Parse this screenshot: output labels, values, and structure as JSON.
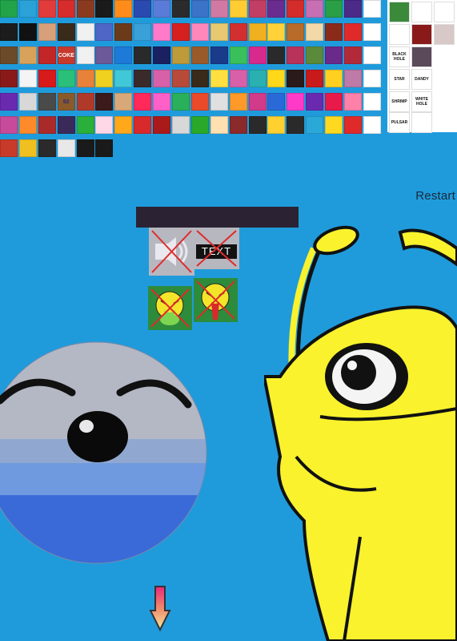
{
  "header": {
    "restart_label": "Restart"
  },
  "icon_grid": {
    "rows": [
      [
        "#22a34a",
        "#2aa2d8",
        "#e23b3b",
        "#d62c2c",
        "#8a3b1f",
        "#1a1a1a",
        "#ff8c1a",
        "#2a4ab0",
        "#5b7bd8",
        "#2b2b2b",
        "#3a73c8",
        "#d07aa3",
        "#ffcc33",
        "#c33e64",
        "#6a2c8e",
        "#d42b2b",
        "#c86fb3",
        "#2a9f45",
        "#4b2a88",
        "#ffffff"
      ],
      [
        "#1c1c1c",
        "#111111",
        "#d8a07a",
        "#3a2a1a",
        "#f0f0f0",
        "#4e67c6",
        "#6b3a1a",
        "#3aa0d8",
        "#ff7ac8",
        "#d61f1f",
        "#ff88bb",
        "#e8c870",
        "#d23030",
        "#f0b020",
        "#ffd23a",
        "#b86c2a",
        "#f3d8a8",
        "#8a2a1a",
        "#e02a2a",
        "#ffffff"
      ],
      [
        "#6b4a2a",
        "#d9a25a",
        "#c22626",
        "#c7392c",
        "#f0f0f0",
        "#6b5a9a",
        "#1d7ad8",
        "#2a2a2a",
        "#1a2060",
        "#bd9a3a",
        "#9a5a2a",
        "#1a3a8a",
        "#3ac05a",
        "#d82a8c",
        "#2a2a2a",
        "#b8325a",
        "#5a8a3a",
        "#6a2a8a",
        "#b22a3a",
        "#ffffff"
      ],
      [
        "#8a1a1a",
        "#f4f4f4",
        "#d81a1a",
        "#2ac07a",
        "#e8823a",
        "#f0d020",
        "#40c8d8",
        "#3a2a2a",
        "#d860a8",
        "#b84a3a",
        "#3a2a1a",
        "#ffe040",
        "#d860a8",
        "#2ab0b0",
        "#ffd81a",
        "#2a1a1a",
        "#c81a1a",
        "#ffd020",
        "#c07aa8",
        "#ffffff"
      ],
      [
        "#6a2ab0",
        "#d8d8d8",
        "#4a4a4a",
        "#8a5a2a",
        "#b03a2a",
        "#3a1a1a",
        "#d8a878",
        "#ff2a5a",
        "#ff60c8",
        "#2ab05a",
        "#e84a2a",
        "#e0e0e0",
        "#ff9a2a",
        "#d23a8a",
        "#2a6ad8",
        "#ff3ac8",
        "#6a2ab0",
        "#e81a4a",
        "#ff80a8",
        "#ffffff"
      ],
      [
        "#c84a9a",
        "#ff8a2a",
        "#aa2a2a",
        "#3a2a5a",
        "#2ab03a",
        "#ffd8e8",
        "#ffa81a",
        "#d82a2a",
        "#aa1a1a",
        "#d8d8d8",
        "#2aa82a",
        "#ffe0b0",
        "#8a2a2a",
        "#2a2a2a",
        "#ffd030",
        "#2a2a2a",
        "#2aa8d8",
        "#ffd820",
        "#e02a2a",
        "#ffffff"
      ],
      [
        "#c83a2a",
        "#f0c020",
        "#2a2a2a",
        "#e8e8e8",
        "#1a1a1a",
        "#1a1a1a",
        "",
        "",
        "",
        "",
        "",
        "",
        "",
        "",
        "",
        "",
        "",
        "",
        "",
        ""
      ]
    ],
    "texts": {
      "coke": "COKE",
      "ninety_two": "92"
    }
  },
  "side_panel": {
    "items": [
      "BLACK HOLE",
      "STAR",
      "DANDY",
      "SHRIMP",
      "WHITE HOLE",
      "PULSAR"
    ]
  },
  "stage": {
    "text_tile_label": "TEXT"
  },
  "colors": {
    "background": "#1f9bdc",
    "character_yellow": "#f9f22d",
    "sick_tile_green": "#2c8c3c",
    "cross_red": "#e02a2a",
    "bar_dark": "#2b2333"
  },
  "icons": {
    "restart": "restart-button",
    "drop": "down-arrow-icon"
  }
}
